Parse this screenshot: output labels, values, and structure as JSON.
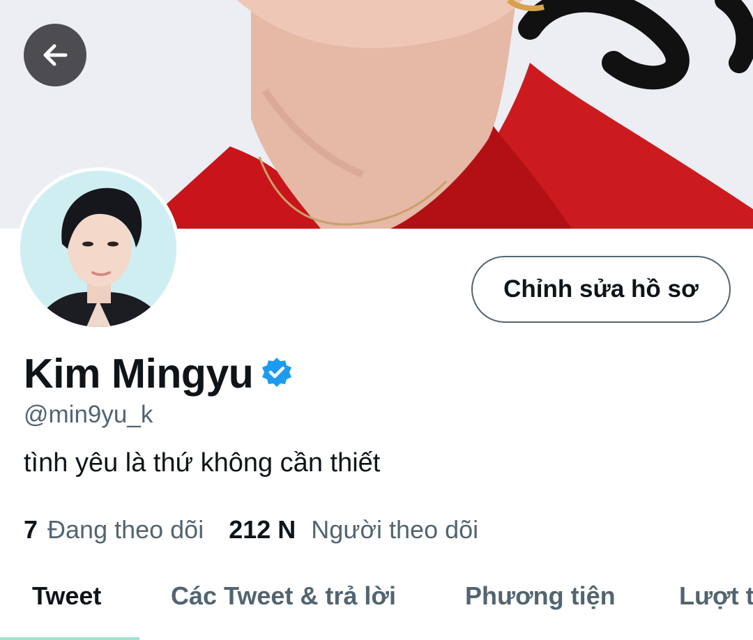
{
  "header": {
    "back_icon": "arrow-left-icon"
  },
  "profile": {
    "edit_button_label": "Chỉnh sửa hồ sơ",
    "display_name": "Kim Mingyu",
    "verified_icon": "verified-badge-icon",
    "verified_color": "#1d9bf0",
    "handle": "@min9yu_k",
    "bio": "tình yêu là thứ không cần thiết"
  },
  "stats": {
    "following_count": "7",
    "following_label": "Đang theo dõi",
    "followers_count": "212 N",
    "followers_label": "Người theo dõi"
  },
  "tabs": [
    {
      "label": "Tweet",
      "active": true
    },
    {
      "label": "Các Tweet & trả lời",
      "active": false
    },
    {
      "label": "Phương tiện",
      "active": false
    },
    {
      "label": "Lượt thích",
      "active": false
    }
  ],
  "colors": {
    "text_primary": "#0f1419",
    "text_secondary": "#536471",
    "tab_indicator": "#9fe3cf"
  }
}
